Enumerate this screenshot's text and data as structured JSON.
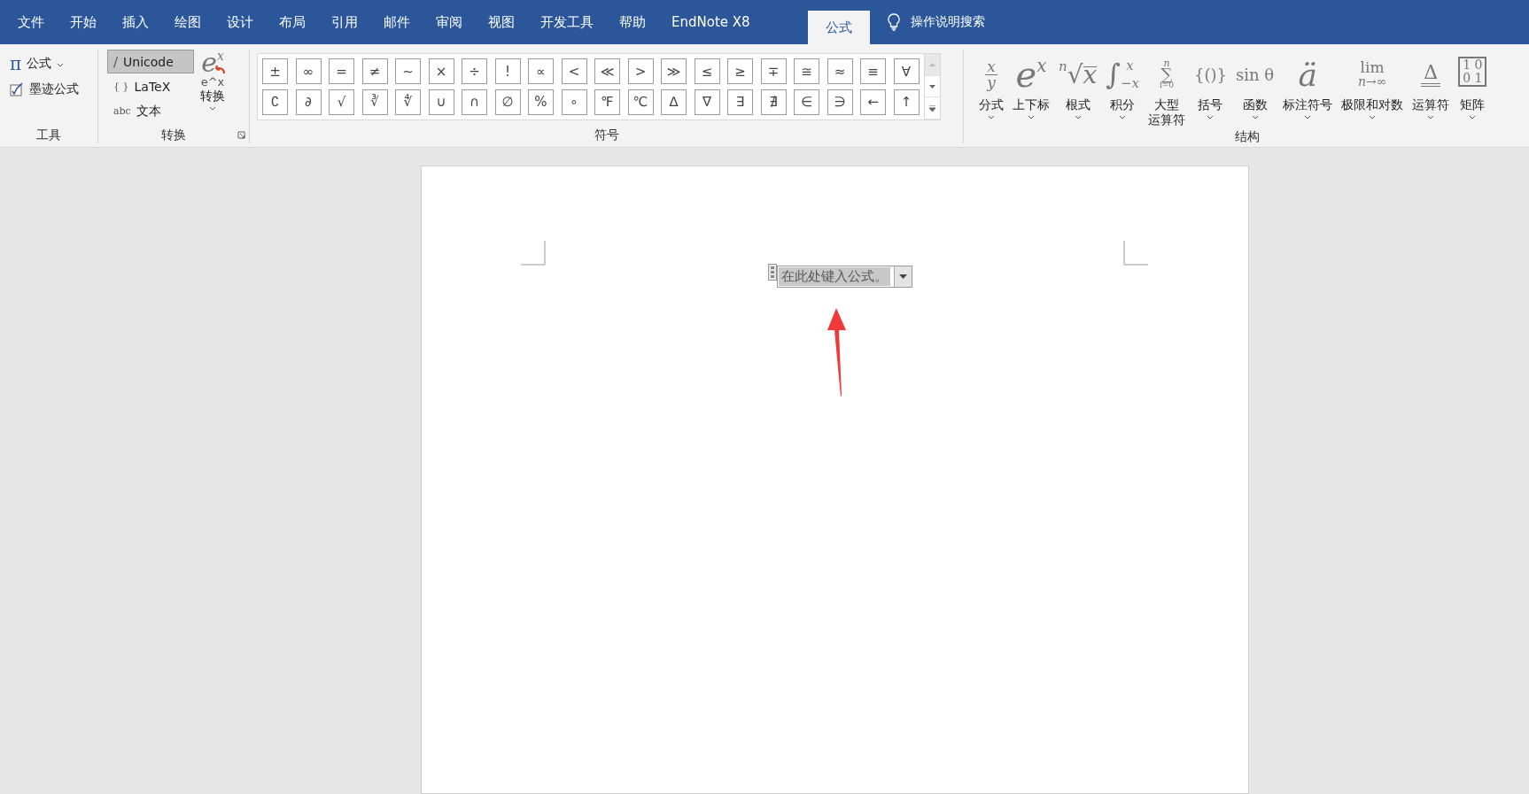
{
  "tabs": [
    {
      "label": "文件",
      "selected": false
    },
    {
      "label": "开始",
      "selected": false
    },
    {
      "label": "插入",
      "selected": false
    },
    {
      "label": "绘图",
      "selected": false
    },
    {
      "label": "设计",
      "selected": false
    },
    {
      "label": "布局",
      "selected": false
    },
    {
      "label": "引用",
      "selected": false
    },
    {
      "label": "邮件",
      "selected": false
    },
    {
      "label": "审阅",
      "selected": false
    },
    {
      "label": "视图",
      "selected": false
    },
    {
      "label": "开发工具",
      "selected": false
    },
    {
      "label": "帮助",
      "selected": false
    },
    {
      "label": "EndNote X8",
      "selected": false
    },
    {
      "label": "公式",
      "selected": true
    }
  ],
  "search": {
    "label": "操作说明搜索"
  },
  "tools": {
    "label": "工具",
    "equation": {
      "glyph": "π",
      "label": "公式"
    },
    "ink": {
      "label": "墨迹公式"
    }
  },
  "conversion": {
    "label": "转换",
    "options": [
      {
        "glyph": "/",
        "label": "Unicode",
        "selected": true
      },
      {
        "glyph": "{ }",
        "label": "LaTeX",
        "selected": false
      },
      {
        "glyph": "abc",
        "label": "文本",
        "selected": false
      }
    ],
    "convert": {
      "base": "e",
      "sup": "x",
      "caption": "e^x",
      "label": "转换"
    }
  },
  "symbols": {
    "label": "符号",
    "rows": [
      [
        "±",
        "∞",
        "=",
        "≠",
        "~",
        "×",
        "÷",
        "!",
        "∝",
        "<",
        "≪",
        ">",
        "≫",
        "≤",
        "≥",
        "∓",
        "≅",
        "≈",
        "≡",
        "∀"
      ],
      [
        "∁",
        "∂",
        "√",
        "∛",
        "∜",
        "∪",
        "∩",
        "∅",
        "%",
        "∘",
        "℉",
        "℃",
        "∆",
        "∇",
        "∃",
        "∄",
        "∈",
        "∋",
        "←",
        "↑"
      ]
    ]
  },
  "structures": {
    "label": "结构",
    "items": [
      {
        "kind": "fraction",
        "parts": [
          "x",
          "y"
        ],
        "label": "分式"
      },
      {
        "kind": "script",
        "parts": [
          "e",
          "x"
        ],
        "label": "上下标"
      },
      {
        "kind": "radical",
        "parts": [
          "n",
          "√",
          "x"
        ],
        "label": "根式"
      },
      {
        "kind": "integral",
        "parts": [
          "∫",
          "x",
          "−x"
        ],
        "label": "积分"
      },
      {
        "kind": "largeop",
        "parts": [
          "n",
          "∑",
          "i=0"
        ],
        "label": [
          "大型",
          "运算符"
        ]
      },
      {
        "kind": "plain",
        "parts": [
          "{()}"
        ],
        "label": "括号"
      },
      {
        "kind": "plain",
        "parts": [
          "sin θ"
        ],
        "label": "函数"
      },
      {
        "kind": "accent",
        "parts": [
          "ä"
        ],
        "label": "标注符号"
      },
      {
        "kind": "limit",
        "parts": [
          "lim",
          "n→∞"
        ],
        "label": "极限和对数"
      },
      {
        "kind": "operator",
        "parts": [
          "Δ"
        ],
        "label": "运算符"
      },
      {
        "kind": "matrix",
        "parts": [
          "1 0",
          "0 1"
        ],
        "label": "矩阵"
      }
    ]
  },
  "document": {
    "placeholder": "在此处键入公式。"
  }
}
